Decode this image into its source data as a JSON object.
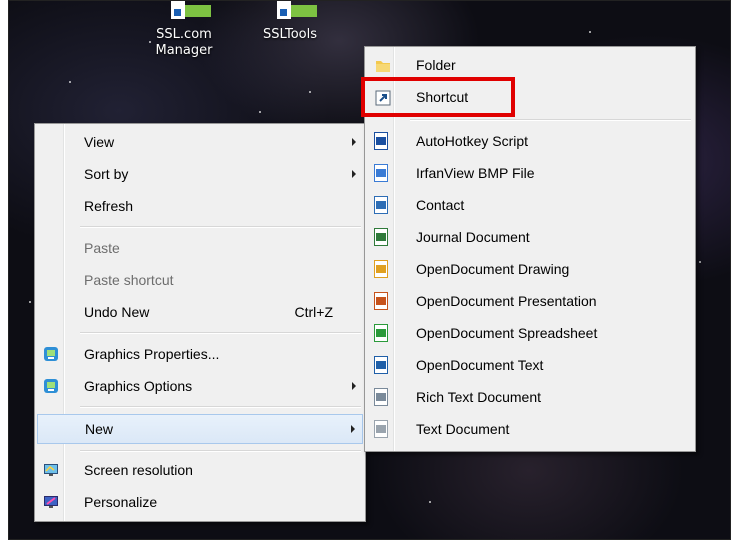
{
  "desktop": {
    "icons": [
      {
        "label_line1": "SSL.com",
        "label_line2": "Manager"
      },
      {
        "label_line1": "SSLTools",
        "label_line2": ""
      }
    ]
  },
  "context_menu": {
    "view": "View",
    "sort_by": "Sort by",
    "refresh": "Refresh",
    "paste": "Paste",
    "paste_shortcut": "Paste shortcut",
    "undo_new": "Undo New",
    "undo_shortcut": "Ctrl+Z",
    "graphics_properties": "Graphics Properties...",
    "graphics_options": "Graphics Options",
    "new": "New",
    "screen_resolution": "Screen resolution",
    "personalize": "Personalize"
  },
  "new_submenu": {
    "folder": "Folder",
    "shortcut": "Shortcut",
    "items": [
      {
        "label": "AutoHotkey Script",
        "icon": "autohotkey-icon",
        "color": "#1a4fa0"
      },
      {
        "label": "IrfanView BMP File",
        "icon": "bmp-file-icon",
        "color": "#3a7bd5"
      },
      {
        "label": "Contact",
        "icon": "contact-icon",
        "color": "#2d6db5"
      },
      {
        "label": "Journal Document",
        "icon": "journal-icon",
        "color": "#2f7a3a"
      },
      {
        "label": "OpenDocument Drawing",
        "icon": "odg-icon",
        "color": "#e0a020"
      },
      {
        "label": "OpenDocument Presentation",
        "icon": "odp-icon",
        "color": "#c6531c"
      },
      {
        "label": "OpenDocument Spreadsheet",
        "icon": "ods-icon",
        "color": "#2a9a3a"
      },
      {
        "label": "OpenDocument Text",
        "icon": "odt-icon",
        "color": "#1f5fa8"
      },
      {
        "label": "Rich Text Document",
        "icon": "rtf-icon",
        "color": "#7a8a9a"
      },
      {
        "label": "Text Document",
        "icon": "txt-icon",
        "color": "#9aa4ae"
      }
    ]
  },
  "highlight_color": "#e00000"
}
